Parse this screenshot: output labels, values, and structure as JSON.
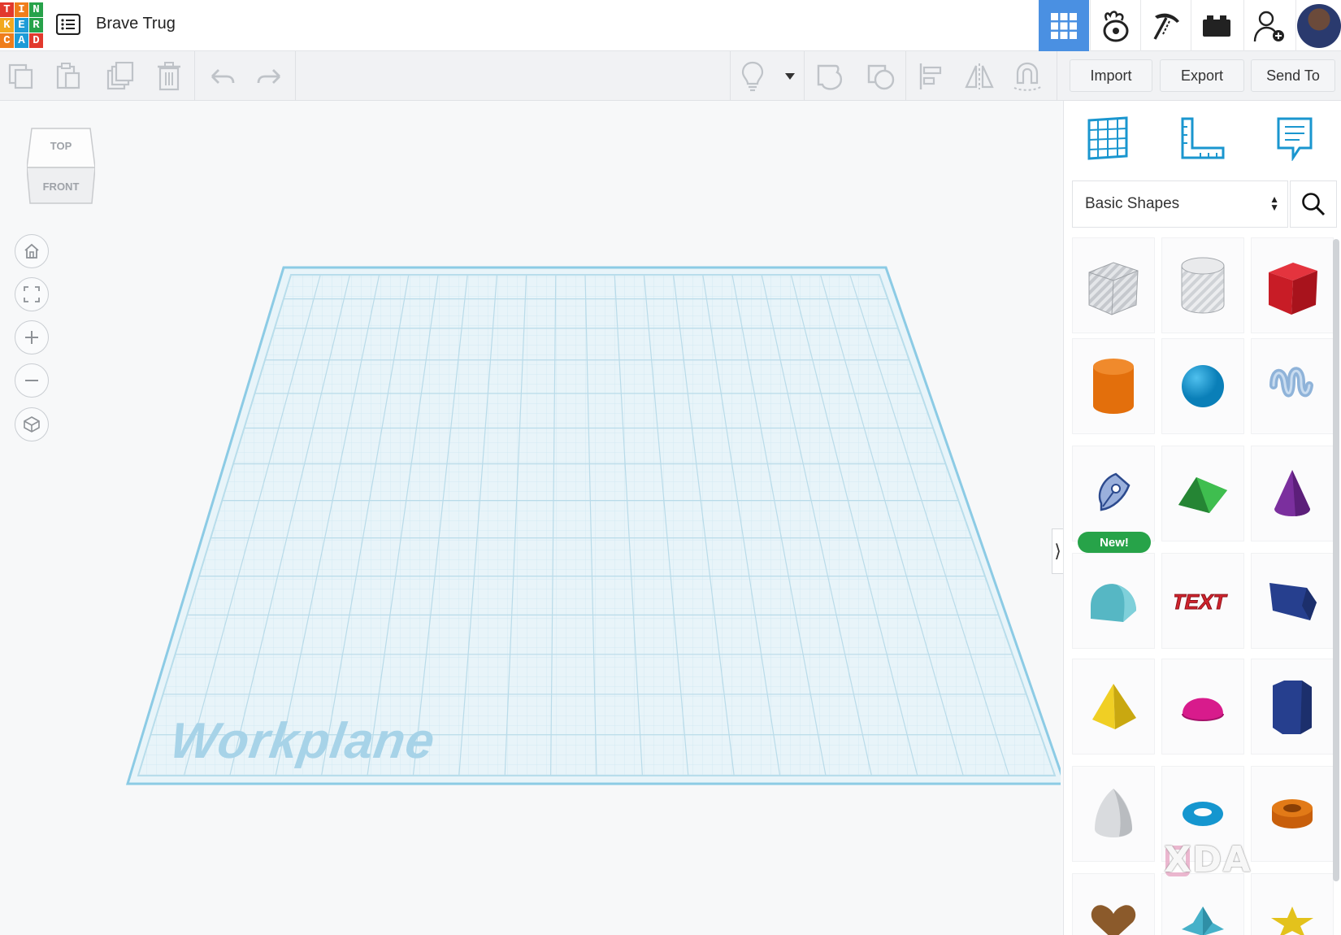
{
  "app": {
    "logo_letters": [
      "T",
      "I",
      "N",
      "K",
      "E",
      "R",
      "C",
      "A",
      "D"
    ],
    "logo_colors": [
      "#e2392d",
      "#ef7d1b",
      "#27a24a",
      "#f1a81e",
      "#1d9bd7",
      "#27a24a",
      "#ef7d1b",
      "#1d9bd7",
      "#e2392d"
    ],
    "design_title": "Brave Trug",
    "accent": "#4a90e2"
  },
  "topbar": {
    "icons": [
      "grid-view-icon",
      "simulation-icon",
      "build-icon",
      "blocks-icon",
      "invite-user-icon",
      "avatar"
    ]
  },
  "toolbar": {
    "import_label": "Import",
    "export_label": "Export",
    "send_to_label": "Send To"
  },
  "canvas": {
    "view_cube_top": "TOP",
    "view_cube_front": "FRONT",
    "workplane_label": "Workplane",
    "workplane_line": "#8ccbe5",
    "workplane_fill": "#e6f3f8"
  },
  "panel": {
    "library_select": "Basic Shapes",
    "new_badge": "New!",
    "shapes": [
      {
        "name": "box-hole",
        "color": "#b9bcc2"
      },
      {
        "name": "cylinder-hole",
        "color": "#c8cbd0"
      },
      {
        "name": "box",
        "color": "#d41f2a"
      },
      {
        "name": "cylinder",
        "color": "#e8740e"
      },
      {
        "name": "sphere",
        "color": "#1696d2"
      },
      {
        "name": "scribble",
        "color": "#8fb3d9"
      },
      {
        "name": "shape-generator",
        "color": "#9ab0dc"
      },
      {
        "name": "roof",
        "color": "#2e9e3e"
      },
      {
        "name": "cone",
        "color": "#7b2f9e"
      },
      {
        "name": "round-roof",
        "color": "#56b7c4"
      },
      {
        "name": "text",
        "color": "#d1242e"
      },
      {
        "name": "wedge",
        "color": "#263f8e"
      },
      {
        "name": "pyramid",
        "color": "#e7c31a"
      },
      {
        "name": "half-sphere",
        "color": "#d81b8c"
      },
      {
        "name": "polygon",
        "color": "#263f8e"
      },
      {
        "name": "paraboloid",
        "color": "#cfd1d4"
      },
      {
        "name": "torus",
        "color": "#1596cf"
      },
      {
        "name": "tube",
        "color": "#e27a17"
      },
      {
        "name": "heart",
        "color": "#8b5a2b"
      },
      {
        "name": "star-gem",
        "color": "#46b1c9"
      },
      {
        "name": "star",
        "color": "#e3c21c"
      }
    ]
  },
  "watermark": "XDA"
}
